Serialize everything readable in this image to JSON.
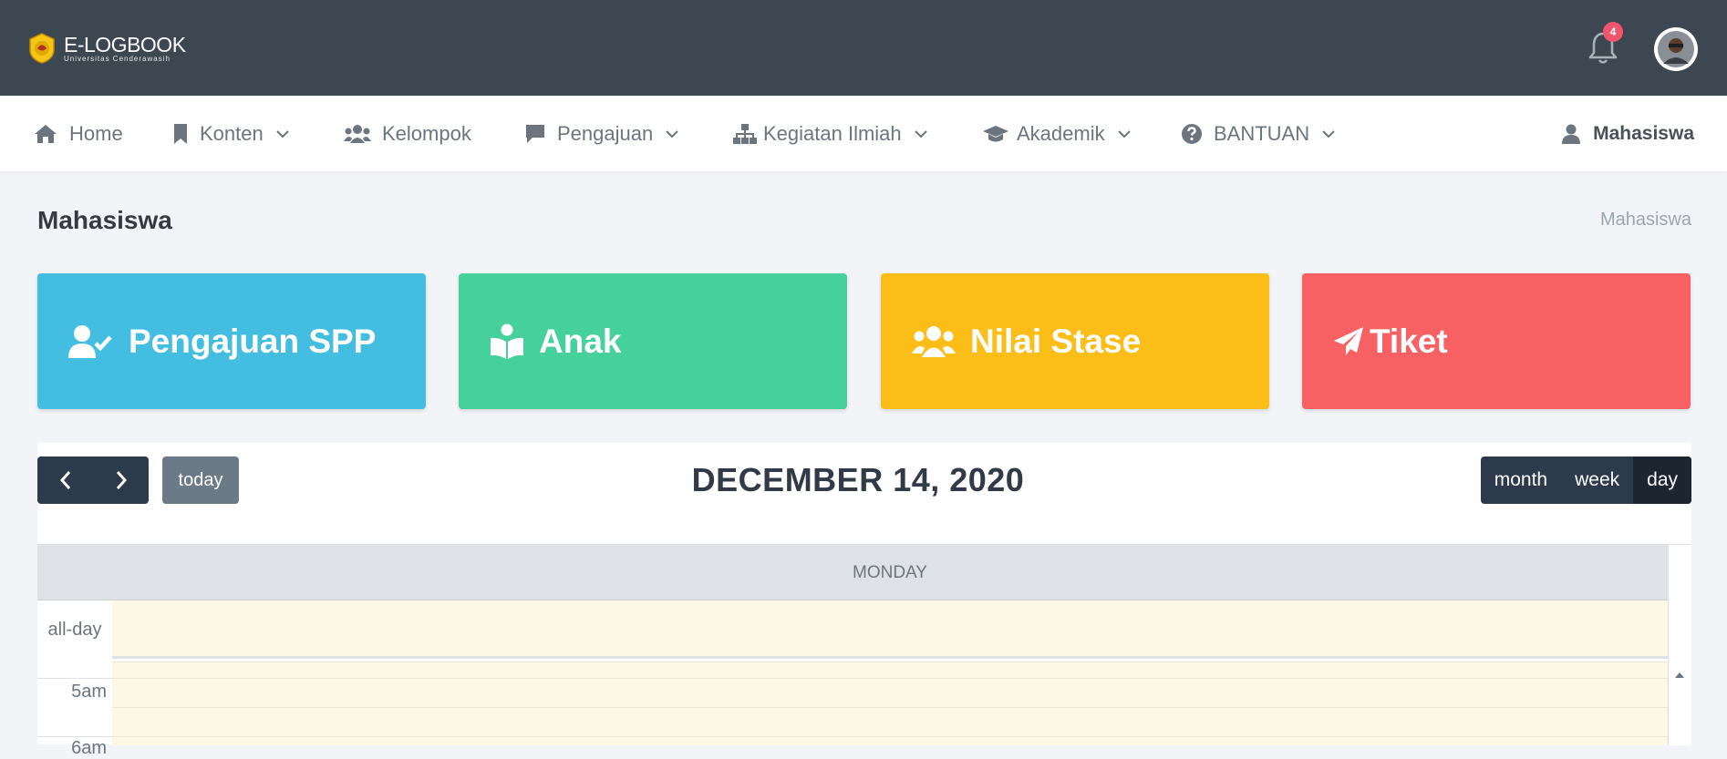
{
  "topbar": {
    "brand_title": "E-LOGBOOK",
    "brand_subtitle": "Universitas Cenderawasih",
    "notification_count": "4"
  },
  "nav": {
    "items": [
      {
        "label": "Home",
        "icon": "home-icon",
        "dropdown": false
      },
      {
        "label": "Konten",
        "icon": "bookmark-icon",
        "dropdown": true
      },
      {
        "label": "Kelompok",
        "icon": "users-icon",
        "dropdown": false
      },
      {
        "label": "Pengajuan",
        "icon": "comment-icon",
        "dropdown": true
      },
      {
        "label": "Kegiatan Ilmiah",
        "icon": "sitemap-icon",
        "dropdown": true
      },
      {
        "label": "Akademik",
        "icon": "graduation-cap-icon",
        "dropdown": true
      },
      {
        "label": "BANTUAN",
        "icon": "question-circle-icon",
        "dropdown": true
      }
    ],
    "user_label": "Mahasiswa"
  },
  "page": {
    "title": "Mahasiswa",
    "breadcrumb": "Mahasiswa"
  },
  "cards": [
    {
      "label": "Pengajuan SPP",
      "icon": "user-check-icon",
      "color": "#43bee1"
    },
    {
      "label": "Anak",
      "icon": "book-reader-icon",
      "color": "#46d09c"
    },
    {
      "label": "Nilai Stase",
      "icon": "users-icon",
      "color": "#fbbd17"
    },
    {
      "label": "Tiket",
      "icon": "paper-plane-icon",
      "color": "#f76163"
    }
  ],
  "calendar": {
    "today_label": "today",
    "title": "DECEMBER 14, 2020",
    "views": [
      "month",
      "week",
      "day"
    ],
    "active_view": "day",
    "day_header": "MONDAY",
    "allday_label": "all-day",
    "time_labels": [
      "5am",
      "6am"
    ]
  },
  "colors": {
    "topbar": "#3d4752",
    "calendar_button": "#2c3a4b",
    "today_highlight": "#fcf8e3"
  }
}
